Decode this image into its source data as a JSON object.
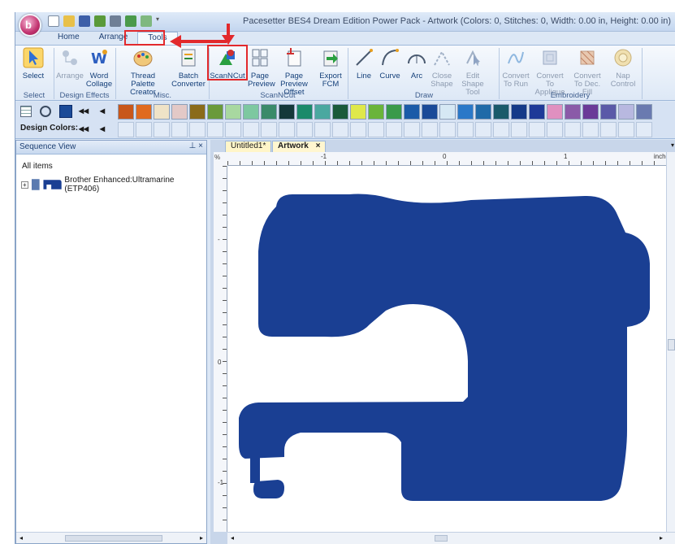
{
  "window": {
    "title": "Pacesetter BES4 Dream Edition Power Pack - Artwork (Colors: 0, Stitches: 0, Width: 0.00 in, Height: 0.00 in)"
  },
  "ribbon_tabs": [
    "Home",
    "Arrange",
    "Tools"
  ],
  "active_tab": "Tools",
  "ribbon": {
    "select": {
      "label": "Select",
      "group": "Select"
    },
    "design_effects": {
      "group": "Design Effects",
      "arrange": "Arrange",
      "word_collage": "Word Collage"
    },
    "misc": {
      "group": "Misc.",
      "thread_palette_creator": "Thread Palette Creator",
      "batch_converter": "Batch Converter"
    },
    "scanncut": {
      "group": "ScanNCut",
      "scanncut": "ScanNCut",
      "page_preview": "Page Preview",
      "page_preview_offset": "Page Preview Offset",
      "export_fcm": "Export FCM"
    },
    "draw": {
      "group": "Draw",
      "line": "Line",
      "curve": "Curve",
      "arc": "Arc",
      "close_shape": "Close Shape",
      "edit_shape_tool": "Edit Shape Tool"
    },
    "embroidery": {
      "group": "Embroidery",
      "convert_to_run": "Convert To Run",
      "convert_to_applique": "Convert To Applique",
      "convert_to_dec_fill": "Convert To Dec. Fill",
      "nap_control": "Nap Control"
    }
  },
  "design_colors_label": "Design Colors:",
  "palette_colors": [
    "#c8571a",
    "#e06a1f",
    "#efe3c7",
    "#e3c9c7",
    "#8a6b1a",
    "#6a9a3a",
    "#a8d8a0",
    "#7dc8a0",
    "#3a8a6a",
    "#14383a",
    "#1a8a6a",
    "#4aa8a0",
    "#1a5a3a",
    "#dfe84a",
    "#6ab43a",
    "#3a9a4a",
    "#1a5aa8",
    "#1a4a98",
    "#d6e8f4",
    "#2a78c8",
    "#1f6aa8",
    "#1a5a6a",
    "#143a88",
    "#1e3a98",
    "#e090c0",
    "#8a5aa8",
    "#6a3a98",
    "#5a5aa8",
    "#b8b8e0",
    "#6a7ab0"
  ],
  "sequence_view": {
    "title": "Sequence View",
    "all_items": "All items",
    "item": "Brother Enhanced:Ultramarine (ETP406)"
  },
  "document_tabs": [
    "Untitled1*",
    "Artwork"
  ],
  "active_document": "Artwork",
  "ruler": {
    "corner": "%",
    "top_labels": [
      "-1",
      "0",
      "1"
    ],
    "left_labels": [
      "-",
      "0",
      "-1"
    ],
    "unit": "inches"
  },
  "design": {
    "shape": "sewing-machine",
    "color": "#1a3f93"
  }
}
